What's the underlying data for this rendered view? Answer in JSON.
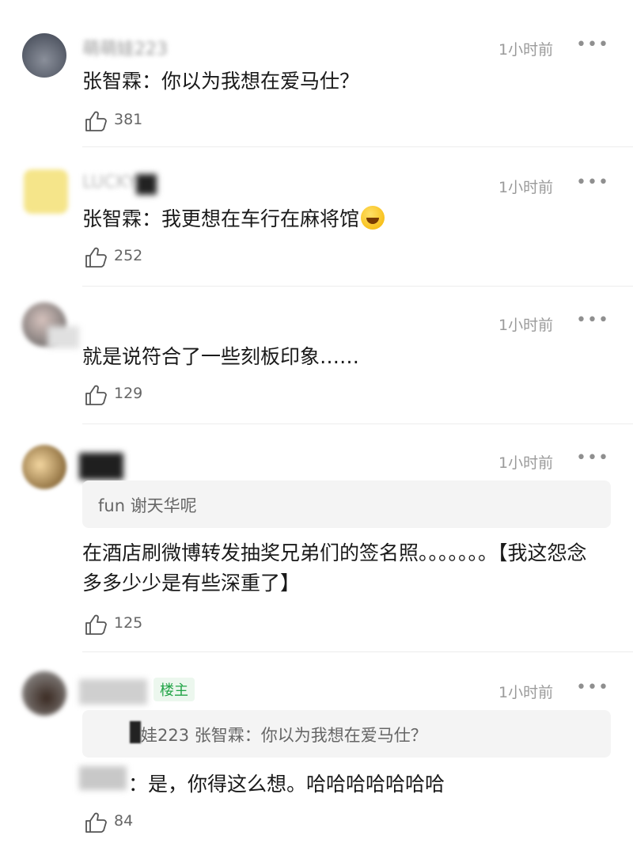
{
  "comments": [
    {
      "name": "萌萌娃223",
      "time": "1小时前",
      "text": "张智霖：你以为我想在爱马仕？",
      "likes": "381"
    },
    {
      "name": "LUCKY",
      "time": "1小时前",
      "text": "张智霖：我更想在车行在麻将馆",
      "emoji": "rofl-emoji",
      "likes": "252"
    },
    {
      "name": "",
      "time": "1小时前",
      "text": "就是说符合了一些刻板印象……",
      "likes": "129"
    },
    {
      "name": "",
      "time": "1小时前",
      "quote": "fun 谢天华呢",
      "text": "在酒店刷微博转发抽奖兄弟们的签名照。。。。。。。【我这怨念多多少少是有些深重了】",
      "likes": "125"
    },
    {
      "name": "",
      "badge": "楼主",
      "time": "1小时前",
      "quote": "娃223 张智霖：你以为我想在爱马仕？",
      "text": "：是，你得这么想。哈哈哈哈哈哈哈",
      "likes": "84"
    }
  ],
  "icons": {
    "like": "thumbs-up-icon",
    "more": "more-dots-icon"
  },
  "colors": {
    "badge_green": "#22a447",
    "badge_bg": "#ecf7ee",
    "muted": "#9a9a9a"
  }
}
